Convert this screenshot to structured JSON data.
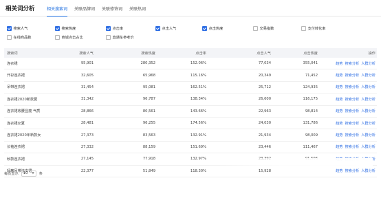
{
  "header": {
    "title": "相关词分析",
    "tabs": [
      {
        "label": "相关搜索词",
        "active": true
      },
      {
        "label": "关联品牌词",
        "active": false
      },
      {
        "label": "关联修饰词",
        "active": false
      },
      {
        "label": "关联热词",
        "active": false
      }
    ]
  },
  "filters": {
    "row1": [
      {
        "label": "搜索人气",
        "checked": true
      },
      {
        "label": "搜索热度",
        "checked": true
      },
      {
        "label": "点击率",
        "checked": true
      },
      {
        "label": "点击人气",
        "checked": true
      },
      {
        "label": "点击热度",
        "checked": true
      },
      {
        "label": "交易指数",
        "checked": false
      },
      {
        "label": "支付转化率",
        "checked": false
      }
    ],
    "row2": [
      {
        "label": "在线商品数",
        "checked": false
      },
      {
        "label": "商城点击占比",
        "checked": false
      },
      {
        "label": "直通车参考价",
        "checked": false
      }
    ]
  },
  "table": {
    "columns": [
      "搜索词",
      "搜索人气",
      "搜索热度",
      "点击率",
      "点击人气",
      "点击热度",
      "操作"
    ],
    "actions": [
      "趋势",
      "搜索分析",
      "人群分析"
    ],
    "rows": [
      [
        "连衣裙",
        "95,901",
        "280,352",
        "152.06%",
        "77,034",
        "355,041"
      ],
      [
        "开衫连衣裙",
        "32,605",
        "65,968",
        "115.16%",
        "20,349",
        "71,452"
      ],
      [
        "吊带连衣裙",
        "31,454",
        "95,081",
        "162.51%",
        "25,712",
        "124,935"
      ],
      [
        "连衣裙2020新款夏",
        "31,342",
        "96,787",
        "138.34%",
        "26,600",
        "116,175"
      ],
      [
        "连衣裙收腰显瘦 气质",
        "28,866",
        "80,561",
        "143.66%",
        "22,963",
        "98,814"
      ],
      [
        "连衣裙女夏",
        "28,481",
        "96,255",
        "174.56%",
        "24,030",
        "131,786"
      ],
      [
        "连衣裙2020年新款女",
        "27,373",
        "83,563",
        "132.91%",
        "21,934",
        "98,009"
      ],
      [
        "长袖连衣裙",
        "27,332",
        "88,159",
        "151.69%",
        "23,446",
        "111,467"
      ],
      [
        "秋款连衣裙",
        "27,145",
        "77,918",
        "132.97%",
        "23,392",
        "91,506"
      ],
      [
        "轻奢吊带连衣裙",
        "22,377",
        "51,849",
        "118.30%",
        "15,928",
        ""
      ]
    ]
  },
  "pager": {
    "prefix": "每页显示",
    "page_size": "10",
    "suffix": "条"
  },
  "colors": {
    "accent": "#2f6fe4",
    "header_bg": "#f3f4f7"
  }
}
